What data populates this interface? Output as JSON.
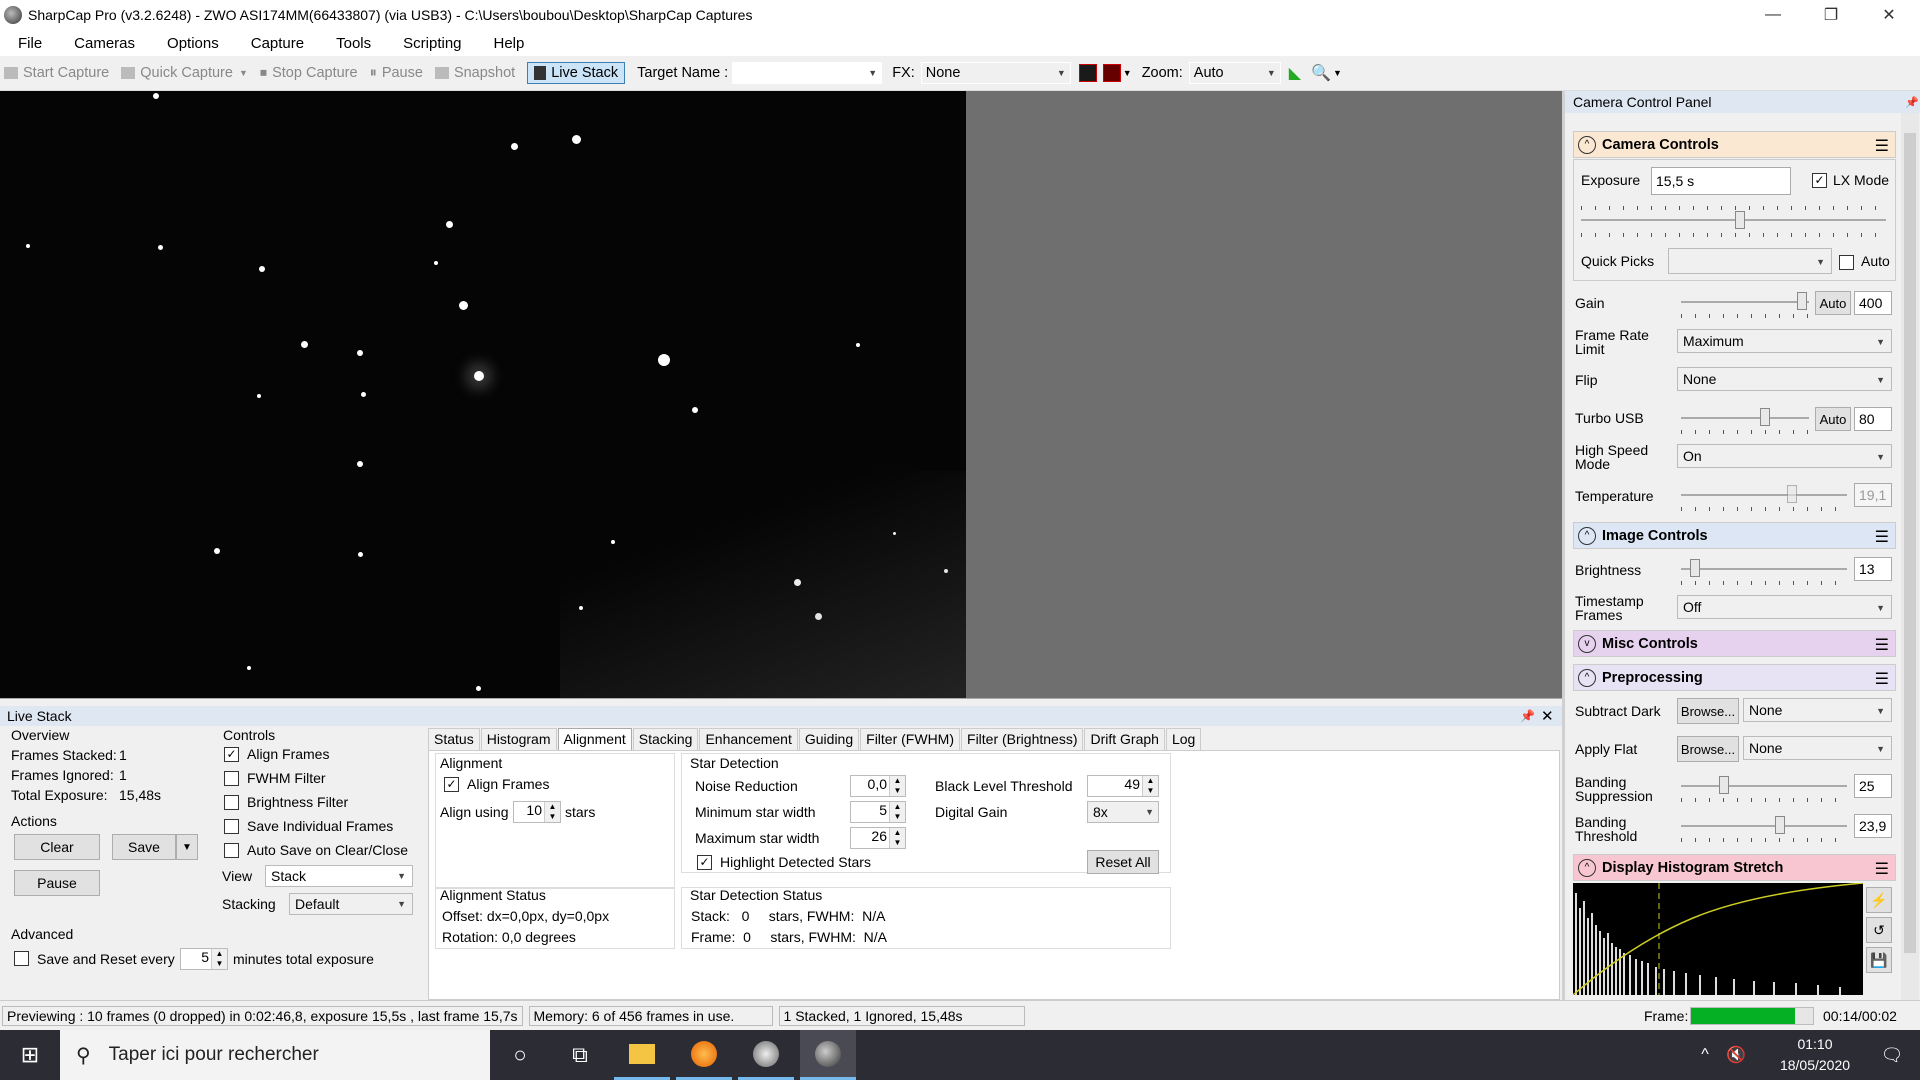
{
  "window": {
    "title": "SharpCap Pro (v3.2.6248) - ZWO ASI174MM(66433807) (via USB3) - C:\\Users\\boubou\\Desktop\\SharpCap Captures",
    "minimize": "—",
    "restore": "❐",
    "close": "✕"
  },
  "menu": [
    "File",
    "Cameras",
    "Options",
    "Capture",
    "Tools",
    "Scripting",
    "Help"
  ],
  "toolbar": {
    "start_capture": "Start Capture",
    "quick_capture": "Quick Capture",
    "stop_capture": "Stop Capture",
    "pause": "Pause",
    "snapshot": "Snapshot",
    "live_stack": "Live Stack",
    "target_name_label": "Target Name :",
    "target_name_value": "",
    "fx_label": "FX:",
    "fx_value": "None",
    "zoom_label": "Zoom:",
    "zoom_value": "Auto"
  },
  "live_stack": {
    "header": "Live Stack",
    "overview": {
      "title": "Overview",
      "frames_stacked_label": "Frames Stacked:",
      "frames_stacked": "1",
      "frames_ignored_label": "Frames Ignored:",
      "frames_ignored": "1",
      "total_exposure_label": "Total Exposure:",
      "total_exposure": "15,48s"
    },
    "actions": {
      "title": "Actions",
      "clear": "Clear",
      "save": "Save",
      "pause": "Pause"
    },
    "advanced": {
      "title": "Advanced",
      "save_reset_label": "Save and Reset every",
      "save_reset_value": "5",
      "save_reset_suffix": "minutes total exposure"
    },
    "controls": {
      "title": "Controls",
      "align_frames": "Align Frames",
      "fwhm_filter": "FWHM Filter",
      "brightness_filter": "Brightness Filter",
      "save_individual": "Save Individual Frames",
      "auto_save": "Auto Save on Clear/Close",
      "view_label": "View",
      "view_value": "Stack",
      "stacking_label": "Stacking",
      "stacking_value": "Default"
    },
    "tabs": [
      "Status",
      "Histogram",
      "Alignment",
      "Stacking",
      "Enhancement",
      "Guiding",
      "Filter (FWHM)",
      "Filter (Brightness)",
      "Drift Graph",
      "Log"
    ],
    "alignment": {
      "title": "Alignment",
      "align_frames": "Align Frames",
      "align_using_label": "Align using",
      "align_using_value": "10",
      "stars_label": "stars",
      "status_title": "Alignment Status",
      "offset": "Offset: dx=0,0px, dy=0,0px",
      "rotation": "Rotation: 0,0 degrees"
    },
    "star_detection": {
      "title": "Star Detection",
      "noise_reduction_label": "Noise Reduction",
      "noise_reduction": "0,0",
      "min_width_label": "Minimum star width",
      "min_width": "5",
      "max_width_label": "Maximum star width",
      "max_width": "26",
      "highlight": "Highlight Detected Stars",
      "black_level_label": "Black Level Threshold",
      "black_level": "49",
      "digital_gain_label": "Digital Gain",
      "digital_gain": "8x",
      "reset_all": "Reset All",
      "status_title": "Star Detection Status",
      "stack_line": "Stack:   0     stars, FWHM:  N/A",
      "frame_line": "Frame:  0     stars, FWHM:  N/A"
    }
  },
  "camera_panel": {
    "header": "Camera Control Panel",
    "camera_controls": {
      "title": "Camera Controls",
      "exposure_label": "Exposure",
      "exposure": "15,5 s",
      "lx_mode": "LX Mode",
      "quick_picks_label": "Quick Picks",
      "auto_label": "Auto",
      "gain_label": "Gain",
      "gain_auto": "Auto",
      "gain": "400",
      "frame_rate_label": "Frame Rate Limit",
      "frame_rate": "Maximum",
      "flip_label": "Flip",
      "flip": "None",
      "turbo_label": "Turbo USB",
      "turbo_auto": "Auto",
      "turbo": "80",
      "high_speed_label": "High Speed Mode",
      "high_speed": "On",
      "temperature_label": "Temperature",
      "temperature": "19,1"
    },
    "image_controls": {
      "title": "Image Controls",
      "brightness_label": "Brightness",
      "brightness": "13",
      "timestamp_label": "Timestamp Frames",
      "timestamp": "Off"
    },
    "misc_controls": {
      "title": "Misc Controls"
    },
    "preprocessing": {
      "title": "Preprocessing",
      "subtract_dark_label": "Subtract Dark",
      "browse": "Browse...",
      "subtract_dark": "None",
      "apply_flat_label": "Apply Flat",
      "apply_flat": "None",
      "banding_supp_label": "Banding Suppression",
      "banding_supp": "25",
      "banding_thresh_label": "Banding Threshold",
      "banding_thresh": "23,9"
    },
    "histogram": {
      "title": "Display Histogram Stretch"
    }
  },
  "status_bar": {
    "previewing": "Previewing : 10 frames (0 dropped) in 0:02:46,8, exposure 15,5s , last frame 15,7s",
    "memory": "Memory: 6 of 456 frames in use.",
    "stacked": "1 Stacked, 1 Ignored, 15,48s",
    "frame_label": "Frame:",
    "frame_progress": 0.85,
    "frame_time": "00:14/00:02"
  },
  "taskbar": {
    "search_placeholder": "Taper ici pour rechercher",
    "time": "01:10",
    "date": "18/05/2020"
  },
  "colors": {
    "camera_controls_header": "#fbe8d3",
    "image_controls_header": "#dde6f5",
    "misc_controls_header": "#e6d2ef",
    "preprocessing_header": "#e7e2f4",
    "histogram_header": "#f8c6d0",
    "frame_bar": "#06b025"
  }
}
